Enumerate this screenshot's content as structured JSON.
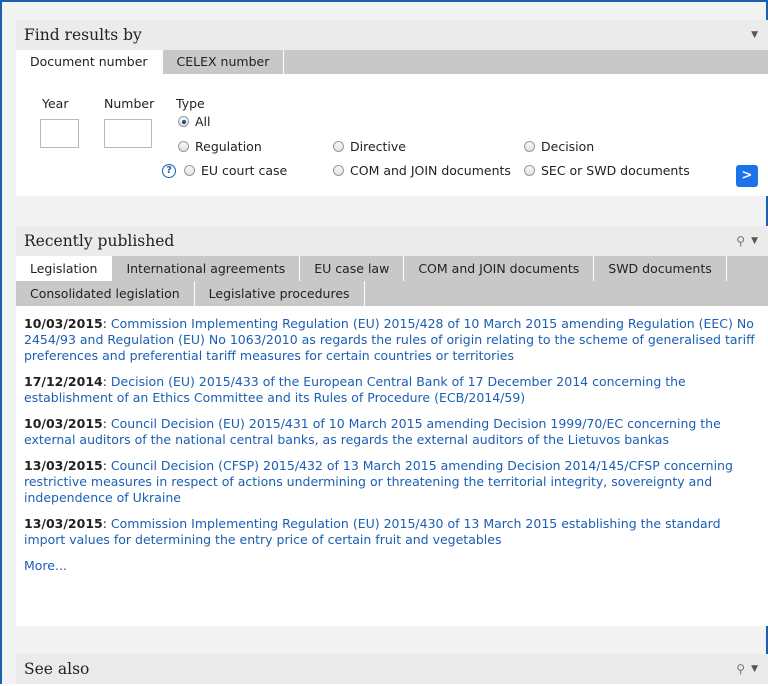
{
  "find": {
    "title": "Find results by",
    "tabs": [
      "Document number",
      "CELEX number"
    ],
    "year_label": "Year",
    "number_label": "Number",
    "type_label": "Type",
    "types": {
      "all": "All",
      "regulation": "Regulation",
      "directive": "Directive",
      "decision": "Decision",
      "court": "EU court case",
      "com": "COM and JOIN documents",
      "sec": "SEC or SWD documents"
    },
    "help_glyph": "?",
    "go_label": ">"
  },
  "recent": {
    "title": "Recently published",
    "tabs_row1": [
      "Legislation",
      "International agreements",
      "EU case law",
      "COM and JOIN documents",
      "SWD documents"
    ],
    "tabs_row2": [
      "Consolidated legislation",
      "Legislative procedures"
    ],
    "items": [
      {
        "date": "10/03/2015",
        "text": "Commission Implementing Regulation (EU) 2015/428 of 10 March 2015 amending Regulation (EEC) No 2454/93 and Regulation (EU) No 1063/2010 as regards the rules of origin relating to the scheme of generalised tariff preferences and preferential tariff measures for certain countries or territories"
      },
      {
        "date": "17/12/2014",
        "text": "Decision (EU) 2015/433 of the European Central Bank of 17 December 2014 concerning the establishment of an Ethics Committee and its Rules of Procedure (ECB/2014/59)"
      },
      {
        "date": "10/03/2015",
        "text": "Council Decision (EU) 2015/431 of 10 March 2015 amending Decision 1999/70/EC concerning the external auditors of the national central banks, as regards the external auditors of the Lietuvos bankas"
      },
      {
        "date": "13/03/2015",
        "text": "Council Decision (CFSP) 2015/432 of 13 March 2015 amending Decision 2014/145/CFSP concerning restrictive measures in respect of actions undermining or threatening the territorial integrity, sovereignty and independence of Ukraine"
      },
      {
        "date": "13/03/2015",
        "text": "Commission Implementing Regulation (EU) 2015/430 of 13 March 2015 establishing the standard import values for determining the entry price of certain fruit and vegetables"
      }
    ],
    "more": "More..."
  },
  "see_also": {
    "title": "See also"
  },
  "icons": {
    "share": "share-icon",
    "collapse": "triangle-down-icon"
  },
  "colors": {
    "link": "#1a5fb4",
    "button": "#1a73e8",
    "frame": "#1a5fb4"
  }
}
